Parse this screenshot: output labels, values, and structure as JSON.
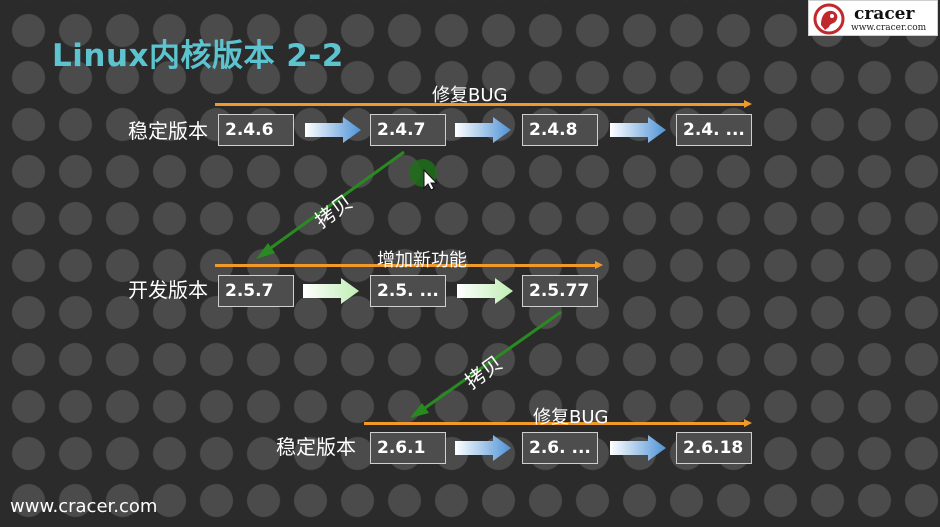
{
  "title": "Linux内核版本 2-2",
  "logo": {
    "brand": "cracer",
    "url": "www.cracer.com"
  },
  "footer": "www.cracer.com",
  "colors": {
    "title": "#5cc3cf",
    "timeline": "#f29a29",
    "copy_arrow": "#2a8a22",
    "box_fill": "#4d4d4d",
    "blue_arrow": "#5b9bd5",
    "green_arrow": "#c9f0c0"
  },
  "icons": {
    "cursor": "mouse-pointer-icon",
    "highlight": "click-highlight-icon",
    "logo": "cracer-logo-icon"
  },
  "rows": [
    {
      "label": "稳定版本",
      "annotation": "修复BUG",
      "versions": [
        "2.4.6",
        "2.4.7",
        "2.4.8",
        "2.4. ..."
      ],
      "arrow_style": "blue"
    },
    {
      "label": "开发版本",
      "annotation": "增加新功能",
      "versions": [
        "2.5.7",
        "2.5. ...",
        "2.5.77"
      ],
      "arrow_style": "green"
    },
    {
      "label": "稳定版本",
      "annotation": "修复BUG",
      "versions": [
        "2.6.1",
        "2.6. ...",
        "2.6.18"
      ],
      "arrow_style": "blue"
    }
  ],
  "copy_labels": [
    "拷贝",
    "拷贝"
  ]
}
